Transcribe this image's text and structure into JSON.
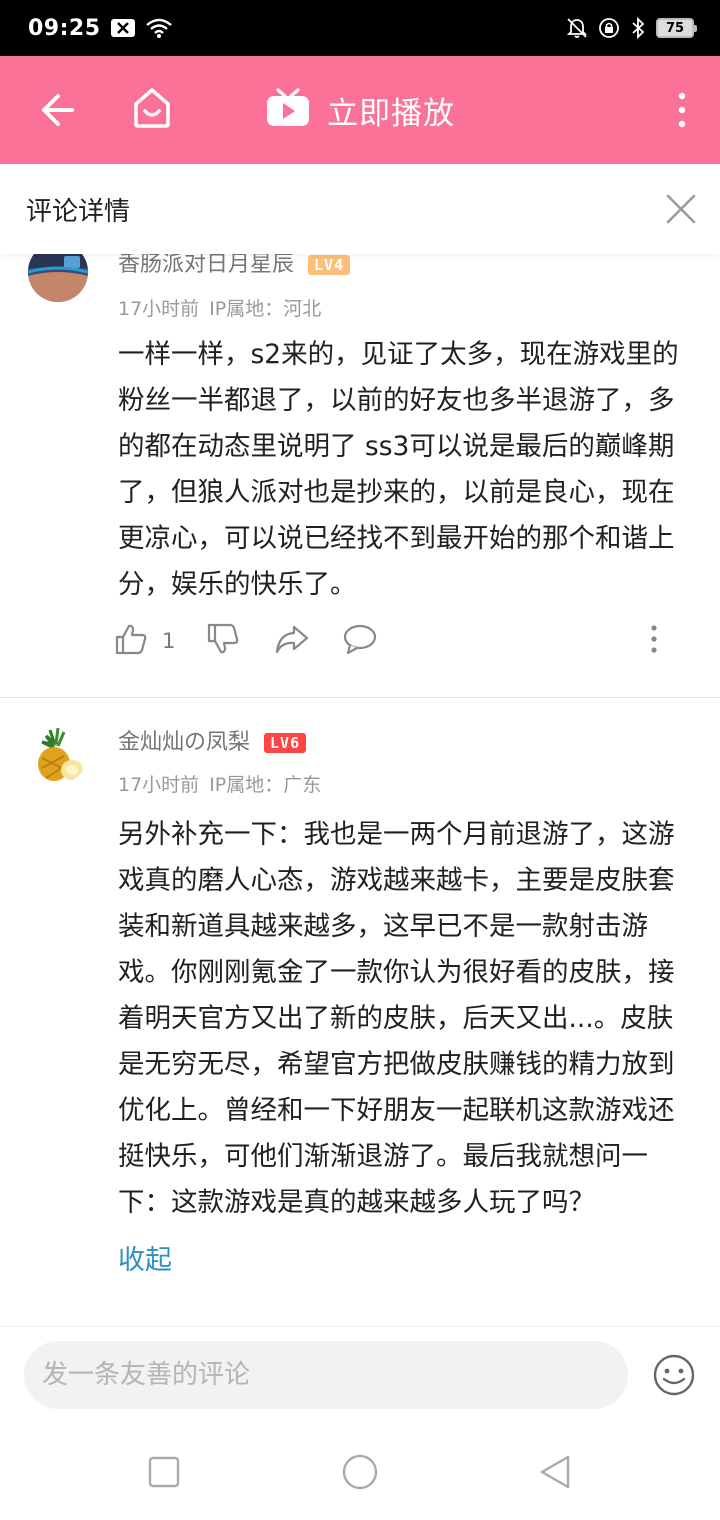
{
  "status_bar": {
    "time": "09:25",
    "battery": "75"
  },
  "header": {
    "play_label": "立即播放",
    "icons": [
      "back-arrow-icon",
      "home-tv-icon",
      "tv-play-icon",
      "more-vertical-icon"
    ],
    "background": "#fb7299"
  },
  "sub_header": {
    "title": "评论详情"
  },
  "comments": [
    {
      "username": "香肠派对日月星辰",
      "level": "LV4",
      "level_color": "#fcbf7a",
      "time": "17小时前",
      "location": "IP属地：河北",
      "text": "一样一样，s2来的，见证了太多，现在游戏里的粉丝一半都退了，以前的好友也多半退游了，多的都在动态里说明了 ss3可以说是最后的巅峰期了，但狼人派对也是抄来的，以前是良心，现在更凉心，可以说已经找不到最开始的那个和谐上分，娱乐的快乐了。",
      "likes": "1"
    },
    {
      "username": "金灿灿の凤梨",
      "level": "LV6",
      "level_color": "#ff4444",
      "time": "17小时前",
      "location": "IP属地：广东",
      "text": "另外补充一下：我也是一两个月前退游了，这游戏真的磨人心态，游戏越来越卡，主要是皮肤套装和新道具越来越多，这早已不是一款射击游戏。你刚刚氪金了一款你认为很好看的皮肤，接着明天官方又出了新的皮肤，后天又出...。皮肤是无穷无尽，希望官方把做皮肤赚钱的精力放到优化上。曾经和一下好朋友一起联机这款游戏还挺快乐，可他们渐渐退游了。最后我就想问一下：这款游戏是真的越来越多人玩了吗？",
      "collapse": "收起"
    }
  ],
  "input_bar": {
    "placeholder": "发一条友善的评论"
  }
}
